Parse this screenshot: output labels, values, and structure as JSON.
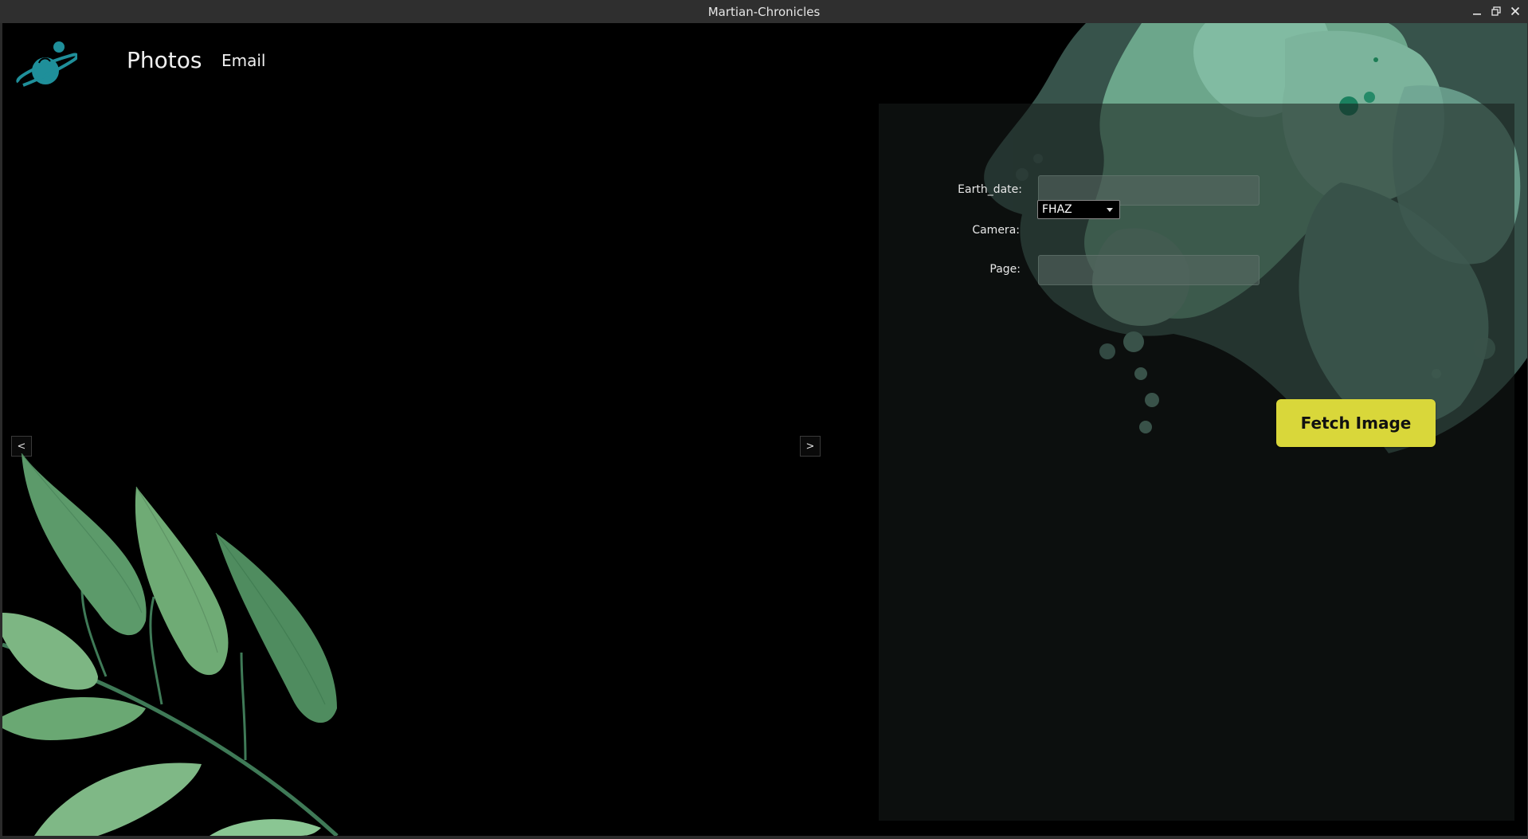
{
  "window": {
    "title": "Martian-Chronicles",
    "controls": [
      "minimize-icon",
      "maximize-icon",
      "close-icon"
    ]
  },
  "nav": {
    "photos_label": "Photos",
    "email_label": "Email"
  },
  "carousel": {
    "prev_label": "<",
    "next_label": ">"
  },
  "form": {
    "earth_date_label": "Earth_date:",
    "earth_date_value": "",
    "camera_label": "Camera:",
    "camera_value": "FHAZ",
    "page_label": "Page:",
    "page_value": "",
    "fetch_label": "Fetch Image"
  },
  "colors": {
    "accent_button": "#d9d73a",
    "logo": "#1f8f9a",
    "splash": "#7ec3a8",
    "leaf": "#4f8f5f"
  }
}
